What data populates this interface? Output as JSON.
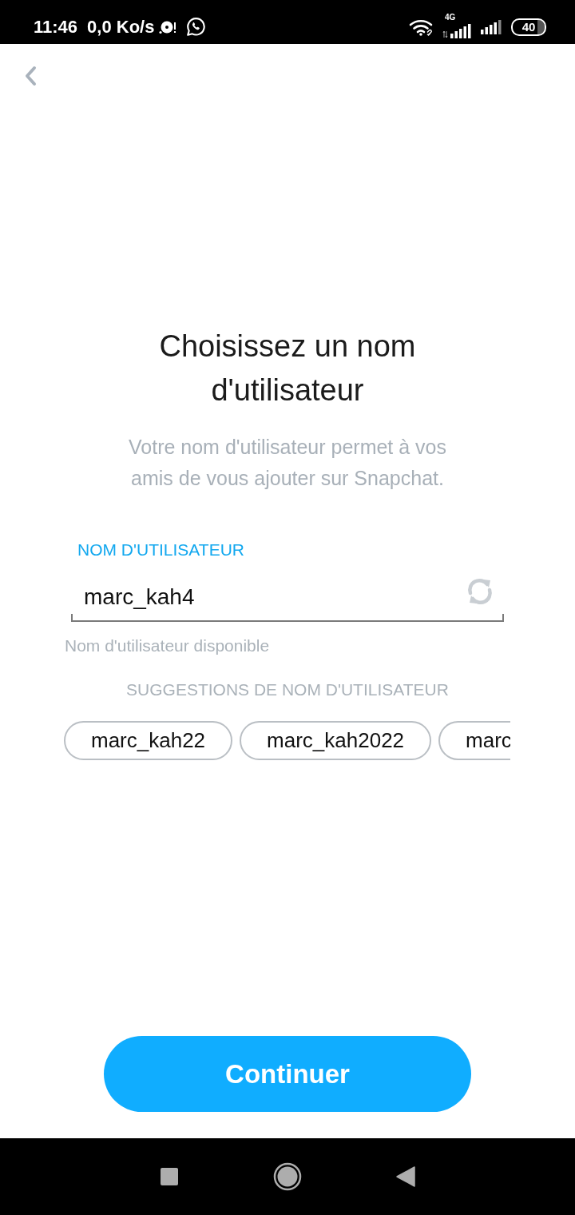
{
  "status_bar": {
    "time": "11:46",
    "net_speed": "0,0 Ko/s",
    "network_type": "4G",
    "battery": "40"
  },
  "title": "Choisissez un nom d'utilisateur",
  "subtitle": "Votre nom d'utilisateur permet à vos amis de vous ajouter sur Snapchat.",
  "username_field": {
    "label": "NOM D'UTILISATEUR",
    "value": "marc_kah4",
    "helper": "Nom d'utilisateur disponible"
  },
  "suggestions": {
    "heading": "SUGGESTIONS DE NOM D'UTILISATEUR",
    "items": [
      {
        "text": "marc_kah22",
        "clipped": false
      },
      {
        "text": "marc_kah2022",
        "clipped": false
      },
      {
        "text": "marc",
        "clipped": true
      }
    ]
  },
  "continue_button": {
    "label": "Continuer"
  }
}
